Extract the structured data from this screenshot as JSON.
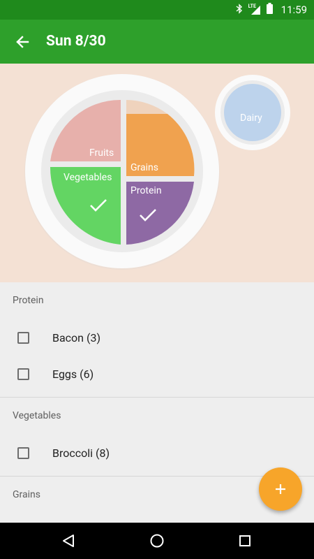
{
  "status_bar": {
    "time": "11:59",
    "network": "LTE"
  },
  "app_bar": {
    "title": "Sun 8/30"
  },
  "plate": {
    "fruits": "Fruits",
    "grains": "Grains",
    "vegetables": "Vegetables",
    "protein": "Protein",
    "dairy": "Dairy"
  },
  "sections": [
    {
      "title": "Protein",
      "items": [
        "Bacon (3)",
        "Eggs (6)"
      ]
    },
    {
      "title": "Vegetables",
      "items": [
        "Broccoli (8)"
      ]
    },
    {
      "title": "Grains",
      "items": []
    }
  ],
  "colors": {
    "status_bar": "#1f8a1c",
    "app_bar": "#2ea02b",
    "fruits": "#e7b0ab",
    "grains": "#f0a24f",
    "vegetables": "#63d563",
    "protein": "#8e69a4",
    "dairy": "#bdd3ec",
    "fab": "#f7a52a"
  }
}
